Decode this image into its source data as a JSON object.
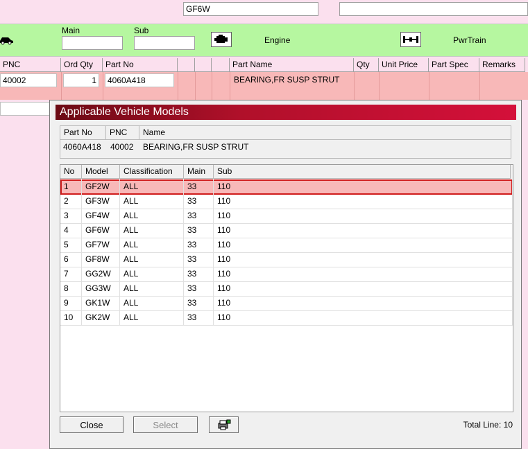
{
  "top": {
    "model_value": "GF6W",
    "search_value": ""
  },
  "greenbar": {
    "main_label": "Main",
    "sub_label": "Sub",
    "main_value": "",
    "sub_value": "",
    "engine_label": "Engine",
    "pwrtrain_label": "PwrTrain"
  },
  "parts_table": {
    "headers": [
      "PNC",
      "Ord Qty",
      "Part No",
      "",
      "",
      "",
      "Part Name",
      "Qty",
      "Unit Price",
      "Part Spec",
      "Remarks"
    ],
    "row": {
      "pnc": "40002",
      "ord_qty": "1",
      "part_no": "4060A418",
      "part_name": "BEARING,FR SUSP STRUT"
    }
  },
  "dialog": {
    "title": "Applicable Vehicle Models",
    "info_headers": [
      "Part No",
      "PNC",
      "Name"
    ],
    "info_row": {
      "part_no": "4060A418",
      "pnc": "40002",
      "name": "BEARING,FR SUSP STRUT"
    },
    "grid_headers": [
      "No",
      "Model",
      "Classification",
      "Main",
      "Sub"
    ],
    "rows": [
      {
        "no": "1",
        "model": "GF2W",
        "classification": "ALL",
        "main": "33",
        "sub": "110"
      },
      {
        "no": "2",
        "model": "GF3W",
        "classification": "ALL",
        "main": "33",
        "sub": "110"
      },
      {
        "no": "3",
        "model": "GF4W",
        "classification": "ALL",
        "main": "33",
        "sub": "110"
      },
      {
        "no": "4",
        "model": "GF6W",
        "classification": "ALL",
        "main": "33",
        "sub": "110"
      },
      {
        "no": "5",
        "model": "GF7W",
        "classification": "ALL",
        "main": "33",
        "sub": "110"
      },
      {
        "no": "6",
        "model": "GF8W",
        "classification": "ALL",
        "main": "33",
        "sub": "110"
      },
      {
        "no": "7",
        "model": "GG2W",
        "classification": "ALL",
        "main": "33",
        "sub": "110"
      },
      {
        "no": "8",
        "model": "GG3W",
        "classification": "ALL",
        "main": "33",
        "sub": "110"
      },
      {
        "no": "9",
        "model": "GK1W",
        "classification": "ALL",
        "main": "33",
        "sub": "110"
      },
      {
        "no": "10",
        "model": "GK2W",
        "classification": "ALL",
        "main": "33",
        "sub": "110"
      }
    ],
    "close_label": "Close",
    "select_label": "Select",
    "total_line": "Total Line: 10",
    "print_icon": "printer-icon"
  },
  "colors": {
    "green_bar": "#b6f7a0",
    "pink_bg": "#fbe0ee",
    "selected_row": "#f8b8b8",
    "title_red": "#c8102e"
  }
}
